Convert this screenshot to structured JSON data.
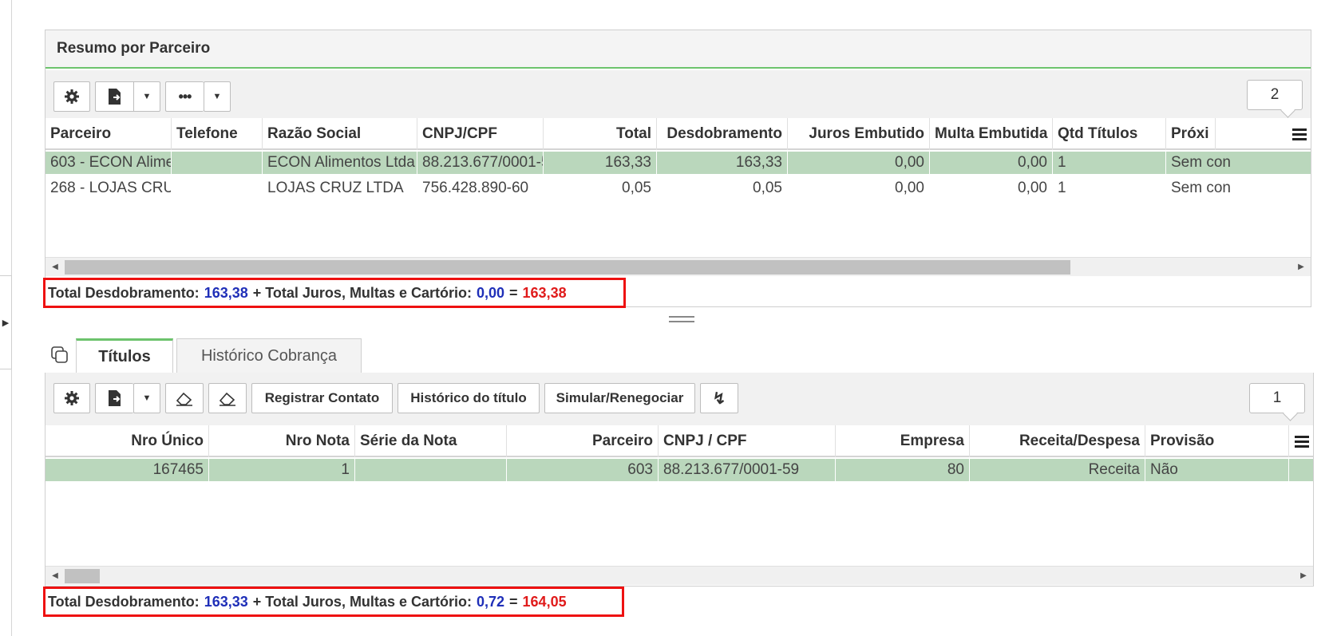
{
  "summary_panel": {
    "title": "Resumo por Parceiro",
    "counter": "2",
    "columns": [
      "Parceiro",
      "Telefone",
      "Razão Social",
      "CNPJ/CPF",
      "Total",
      "Desdobramento",
      "Juros Embutido",
      "Multa Embutida",
      "Qtd Títulos",
      "Próxi"
    ],
    "rows": [
      {
        "parceiro": "603 - ECON Alime",
        "telefone": "",
        "razao": "ECON Alimentos Ltda",
        "cnpj": "88.213.677/0001-5",
        "total": "163,33",
        "desdobramento": "163,33",
        "juros": "0,00",
        "multa": "0,00",
        "qtd": "1",
        "proximo": "Sem con"
      },
      {
        "parceiro": "268 - LOJAS CRU",
        "telefone": "",
        "razao": "LOJAS CRUZ LTDA",
        "cnpj": "756.428.890-60",
        "total": "0,05",
        "desdobramento": "0,05",
        "juros": "0,00",
        "multa": "0,00",
        "qtd": "1",
        "proximo": "Sem con"
      }
    ],
    "totals": {
      "label_desdobramento": "Total Desdobramento:",
      "value_desdobramento": "163,38",
      "label_juros": "+ Total Juros, Multas e Cartório:",
      "value_juros": "0,00",
      "equals": "=",
      "value_total": "163,38"
    }
  },
  "tabs": [
    {
      "label": "Títulos"
    },
    {
      "label": "Histórico Cobrança"
    }
  ],
  "titulos_panel": {
    "counter": "1",
    "buttons": {
      "registrar": "Registrar Contato",
      "historico": "Histórico do título",
      "simular": "Simular/Renegociar"
    },
    "columns": [
      "Nro Único",
      "Nro Nota",
      "Série da Nota",
      "Parceiro",
      "CNPJ / CPF",
      "Empresa",
      "Receita/Despesa",
      "Provisão"
    ],
    "rows": [
      {
        "nro_unico": "167465",
        "nro_nota": "1",
        "serie": "",
        "parceiro": "603",
        "cnpj": "88.213.677/0001-59",
        "empresa": "80",
        "receita": "Receita",
        "provisao": "Não"
      }
    ],
    "totals": {
      "label_desdobramento": "Total Desdobramento:",
      "value_desdobramento": "163,33",
      "label_juros": "+ Total Juros, Multas e Cartório:",
      "value_juros": "0,72",
      "equals": "=",
      "value_total": "164,05"
    }
  },
  "colors": {
    "accent_green": "#6cc36c",
    "selected_row": "#bad7bc",
    "total_blue": "#1f2fb8",
    "total_red": "#e01a1a",
    "highlight_border": "#ee1111"
  },
  "icons": [
    "gear-icon",
    "export-icon",
    "caret-down-icon",
    "more-icon",
    "eraser-icon",
    "lightning-icon",
    "copy-icon",
    "column-menu-icon",
    "collapse-arrow-icon"
  ]
}
